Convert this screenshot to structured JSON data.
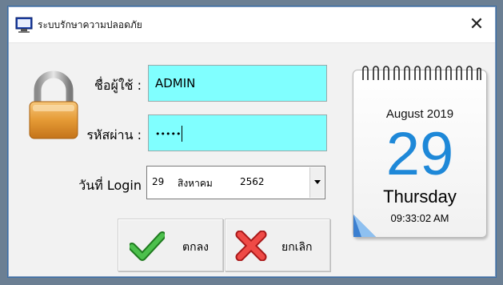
{
  "window": {
    "title": "ระบบรักษาความปลอดภัย",
    "close_glyph": "✕"
  },
  "form": {
    "username_label": "ชื่อผู้ใช้ :",
    "username_value": "ADMIN",
    "password_label": "รหัสผ่าน :",
    "password_value": "•••••",
    "date_label": "วันที่ Login",
    "date_day": "29",
    "date_month": "สิงหาคม",
    "date_year": "2562"
  },
  "buttons": {
    "ok_label": "ตกลง",
    "cancel_label": "ยกเลิก"
  },
  "calendar": {
    "month_year": "August 2019",
    "day": "29",
    "weekday": "Thursday",
    "time": "09:33:02 AM"
  },
  "colors": {
    "field_bg": "#80ffff",
    "calendar_day": "#1e88d8",
    "ok_check": "#2e9e2e",
    "cancel_x": "#e0322f"
  },
  "icons": [
    "app-icon",
    "lock-icon",
    "check-icon",
    "cross-icon",
    "dropdown-arrow-icon",
    "close-icon"
  ]
}
